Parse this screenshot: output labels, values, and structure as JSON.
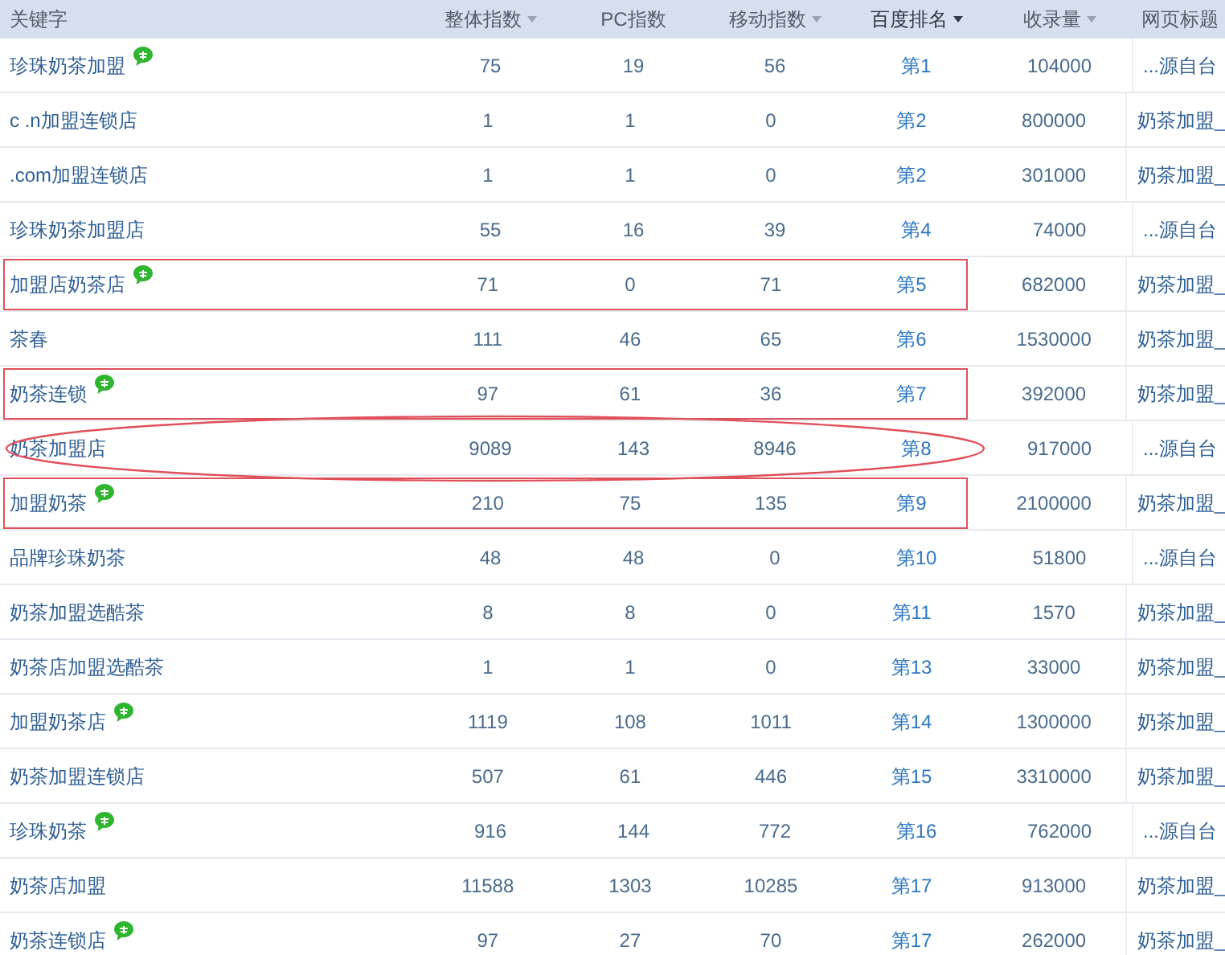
{
  "columns": [
    {
      "label": "关键字",
      "sortable": false,
      "selected": false
    },
    {
      "label": "整体指数",
      "sortable": true,
      "selected": false
    },
    {
      "label": "PC指数",
      "sortable": false,
      "selected": false
    },
    {
      "label": "移动指数",
      "sortable": true,
      "selected": false
    },
    {
      "label": "百度排名",
      "sortable": true,
      "selected": true
    },
    {
      "label": "收录量",
      "sortable": true,
      "selected": false
    },
    {
      "label": "网页标题",
      "sortable": false,
      "selected": false
    }
  ],
  "rows": [
    {
      "keyword": "珍珠奶茶加盟",
      "badge": true,
      "boxed": false,
      "circled": false,
      "overall": "75",
      "pc": "19",
      "mobile": "56",
      "rank": "第1",
      "indexed": "104000",
      "title": "...源自台"
    },
    {
      "keyword": "c .n加盟连锁店",
      "badge": false,
      "boxed": false,
      "circled": false,
      "overall": "1",
      "pc": "1",
      "mobile": "0",
      "rank": "第2",
      "indexed": "800000",
      "title": "奶茶加盟_"
    },
    {
      "keyword": ".com加盟连锁店",
      "badge": false,
      "boxed": false,
      "circled": false,
      "overall": "1",
      "pc": "1",
      "mobile": "0",
      "rank": "第2",
      "indexed": "301000",
      "title": "奶茶加盟_"
    },
    {
      "keyword": "珍珠奶茶加盟店",
      "badge": false,
      "boxed": false,
      "circled": false,
      "overall": "55",
      "pc": "16",
      "mobile": "39",
      "rank": "第4",
      "indexed": "74000",
      "title": "...源自台"
    },
    {
      "keyword": "加盟店奶茶店",
      "badge": true,
      "boxed": true,
      "circled": false,
      "overall": "71",
      "pc": "0",
      "mobile": "71",
      "rank": "第5",
      "indexed": "682000",
      "title": "奶茶加盟_"
    },
    {
      "keyword": "茶春",
      "badge": false,
      "boxed": false,
      "circled": false,
      "overall": "111",
      "pc": "46",
      "mobile": "65",
      "rank": "第6",
      "indexed": "1530000",
      "title": "奶茶加盟_"
    },
    {
      "keyword": "奶茶连锁",
      "badge": true,
      "boxed": true,
      "circled": false,
      "overall": "97",
      "pc": "61",
      "mobile": "36",
      "rank": "第7",
      "indexed": "392000",
      "title": "奶茶加盟_"
    },
    {
      "keyword": "奶茶加盟店",
      "badge": false,
      "boxed": false,
      "circled": true,
      "overall": "9089",
      "pc": "143",
      "mobile": "8946",
      "rank": "第8",
      "indexed": "917000",
      "title": "...源自台"
    },
    {
      "keyword": "加盟奶茶",
      "badge": true,
      "boxed": true,
      "circled": false,
      "overall": "210",
      "pc": "75",
      "mobile": "135",
      "rank": "第9",
      "indexed": "2100000",
      "title": "奶茶加盟_"
    },
    {
      "keyword": "品牌珍珠奶茶",
      "badge": false,
      "boxed": false,
      "circled": false,
      "overall": "48",
      "pc": "48",
      "mobile": "0",
      "rank": "第10",
      "indexed": "51800",
      "title": "...源自台"
    },
    {
      "keyword": "奶茶加盟选酷茶",
      "badge": false,
      "boxed": false,
      "circled": false,
      "overall": "8",
      "pc": "8",
      "mobile": "0",
      "rank": "第11",
      "indexed": "1570",
      "title": "奶茶加盟_"
    },
    {
      "keyword": "奶茶店加盟选酷茶",
      "badge": false,
      "boxed": false,
      "circled": false,
      "overall": "1",
      "pc": "1",
      "mobile": "0",
      "rank": "第13",
      "indexed": "33000",
      "title": "奶茶加盟_"
    },
    {
      "keyword": "加盟奶茶店",
      "badge": true,
      "boxed": false,
      "circled": false,
      "overall": "1119",
      "pc": "108",
      "mobile": "1011",
      "rank": "第14",
      "indexed": "1300000",
      "title": "奶茶加盟_"
    },
    {
      "keyword": "奶茶加盟连锁店",
      "badge": false,
      "boxed": false,
      "circled": false,
      "overall": "507",
      "pc": "61",
      "mobile": "446",
      "rank": "第15",
      "indexed": "3310000",
      "title": "奶茶加盟_"
    },
    {
      "keyword": "珍珠奶茶",
      "badge": true,
      "boxed": false,
      "circled": false,
      "overall": "916",
      "pc": "144",
      "mobile": "772",
      "rank": "第16",
      "indexed": "762000",
      "title": "...源自台"
    },
    {
      "keyword": "奶茶店加盟",
      "badge": false,
      "boxed": false,
      "circled": false,
      "overall": "11588",
      "pc": "1303",
      "mobile": "10285",
      "rank": "第17",
      "indexed": "913000",
      "title": "奶茶加盟_"
    },
    {
      "keyword": "奶茶连锁店",
      "badge": true,
      "boxed": false,
      "circled": false,
      "overall": "97",
      "pc": "27",
      "mobile": "70",
      "rank": "第17",
      "indexed": "262000",
      "title": "奶茶加盟_"
    }
  ]
}
